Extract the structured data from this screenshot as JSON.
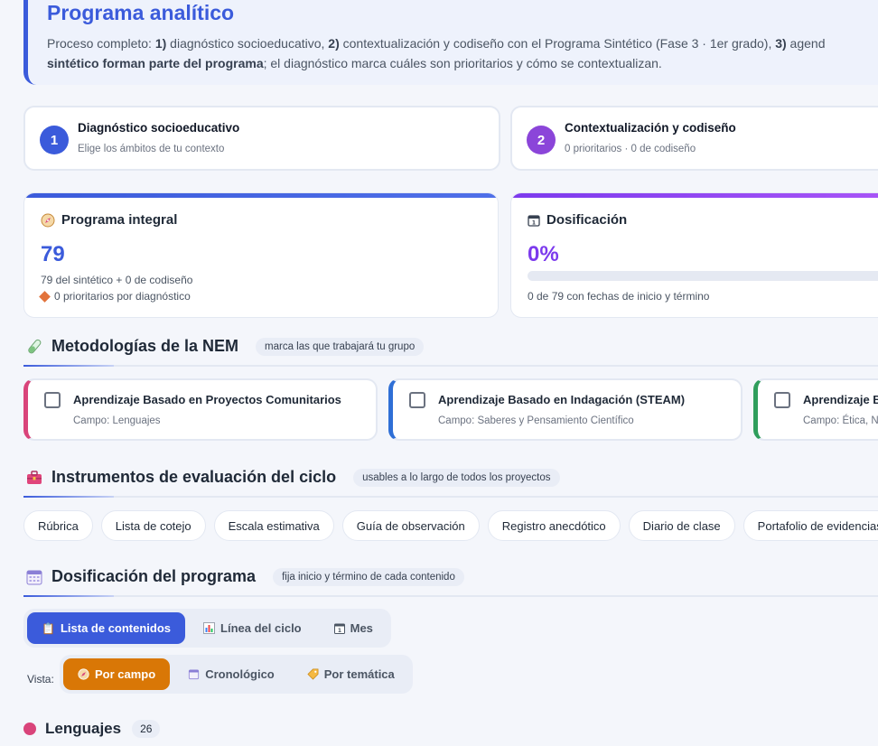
{
  "header": {
    "title": "Programa analítico",
    "desc_prefix": "Proceso completo: ",
    "step1_num": "1)",
    "step1_text": " diagnóstico socioeducativo, ",
    "step2_num": "2)",
    "step2_text": " contextualización y codiseño con el Programa Sintético (Fase 3 · 1er grado), ",
    "step3_num": "3)",
    "step3_text": " agend",
    "line2_bold": "sintético forman parte del programa",
    "line2_rest": "; el diagnóstico marca cuáles son prioritarios y cómo se contextualizan."
  },
  "steps": [
    {
      "num": "1",
      "title": "Diagnóstico socioeducativo",
      "subtitle": "Elige los ámbitos de tu contexto",
      "color": "#3b5bdb"
    },
    {
      "num": "2",
      "title": "Contextualización y codiseño",
      "subtitle": "0 prioritarios · 0 de codiseño",
      "color": "#8b45d9"
    }
  ],
  "stats": {
    "integral": {
      "icon": "compass-icon",
      "title": "Programa integral",
      "value": "79",
      "line1": "79 del sintético + 0 de codiseño",
      "line2": "0 prioritarios por diagnóstico"
    },
    "dosificacion": {
      "icon": "calendar-icon",
      "title": "Dosificación",
      "value": "0%",
      "progress": 0,
      "line1": "0 de 79 con fechas de inicio y término"
    }
  },
  "metodologias": {
    "title": "Metodologías de la NEM",
    "pill": "marca las que trabajará tu grupo",
    "items": [
      {
        "title": "Aprendizaje Basado en Proyectos Comunitarios",
        "subtitle": "Campo: Lenguajes",
        "color": "#d9447a"
      },
      {
        "title": "Aprendizaje Basado en Indagación (STEAM)",
        "subtitle": "Campo: Saberes y Pensamiento Científico",
        "color": "#2f6fd6"
      },
      {
        "title": "Aprendizaje B",
        "subtitle": "Campo: Ética, Na",
        "color": "#2f9e5c"
      }
    ]
  },
  "instrumentos": {
    "title": "Instrumentos de evaluación del ciclo",
    "pill": "usables a lo largo de todos los proyectos",
    "chips": [
      "Rúbrica",
      "Lista de cotejo",
      "Escala estimativa",
      "Guía de observación",
      "Registro anecdótico",
      "Diario de clase",
      "Portafolio de evidencias"
    ]
  },
  "dosificacion_programa": {
    "title": "Dosificación del programa",
    "pill": "fija inicio y término de cada contenido",
    "tabs": [
      {
        "label": "Lista de contenidos",
        "icon": "clipboard-icon",
        "active": true
      },
      {
        "label": "Línea del ciclo",
        "icon": "bar-chart-icon",
        "active": false
      },
      {
        "label": "Mes",
        "icon": "calendar-day-icon",
        "active": false
      }
    ],
    "vista_label": "Vista:",
    "views": [
      {
        "label": "Por campo",
        "icon": "compass-icon",
        "active": true
      },
      {
        "label": "Cronológico",
        "icon": "calendar-icon",
        "active": false
      },
      {
        "label": "Por temática",
        "icon": "tag-icon",
        "active": false
      }
    ]
  },
  "group": {
    "name": "Lenguajes",
    "count": "26",
    "color": "#d9447a"
  }
}
